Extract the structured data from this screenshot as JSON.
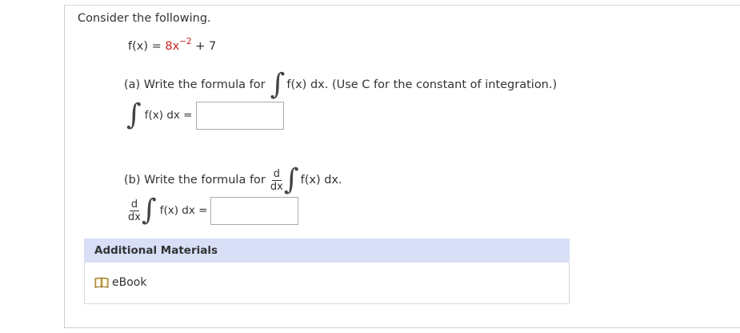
{
  "question": {
    "intro": "Consider the following.",
    "function": {
      "lhs": "f(x) = ",
      "expr_base": "8x",
      "expr_exponent": "−2",
      "expr_tail": " + 7"
    },
    "part_a": {
      "prompt_prefix": "(a) Write the formula for ",
      "prompt_suffix": "f(x) dx.  (Use C for the constant of integration.)",
      "answer_label": "f(x) dx =",
      "answer_value": ""
    },
    "part_b": {
      "prompt_prefix": "(b) Write the formula for ",
      "d_num": "d",
      "d_den": "dx",
      "prompt_suffix": "f(x) dx.",
      "answer_label": "f(x) dx =",
      "answer_value": ""
    }
  },
  "materials": {
    "header": "Additional Materials",
    "items": [
      {
        "label": "eBook",
        "icon": "book-icon"
      }
    ]
  },
  "colors": {
    "accent_red": "#cc2222",
    "materials_header_bg": "#d8dff7"
  }
}
